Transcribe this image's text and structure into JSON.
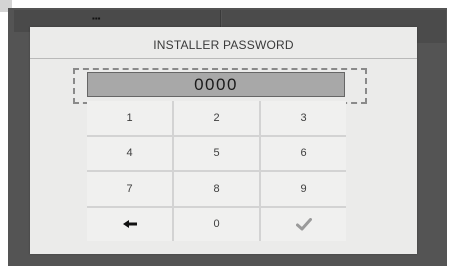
{
  "dialog": {
    "title": "INSTALLER PASSWORD",
    "password_value": "0000"
  },
  "keypad": {
    "keys": [
      "1",
      "2",
      "3",
      "4",
      "5",
      "6",
      "7",
      "8",
      "9",
      "",
      "0",
      ""
    ],
    "backspace_icon": "left-arrow-icon",
    "confirm_icon": "checkmark-icon"
  },
  "colors": {
    "screen_background": "#545454",
    "dialog_background": "#ebebea",
    "password_field": "#a8a8a8",
    "key_background": "#f0f0ef",
    "checkmark": "#9a9a9a"
  }
}
